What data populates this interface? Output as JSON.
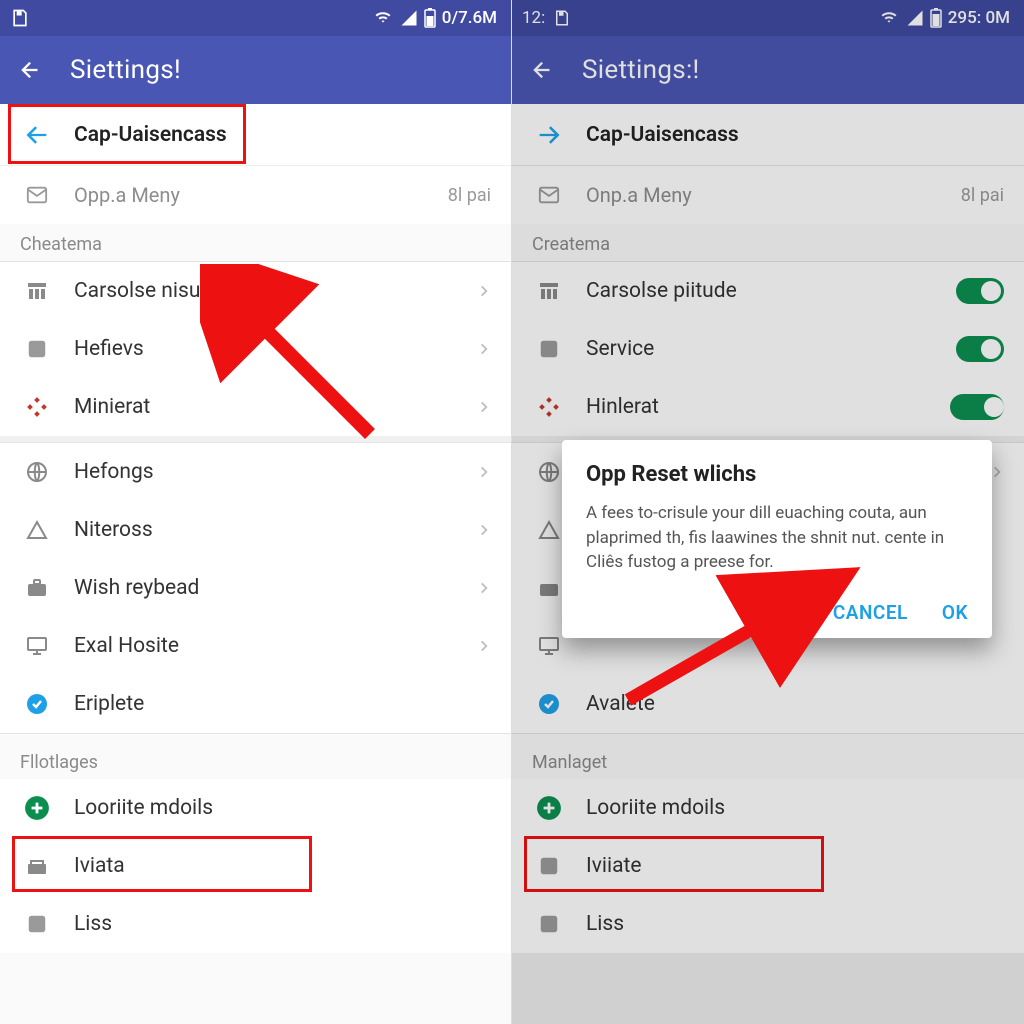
{
  "left": {
    "statusbar": {
      "left_time": "",
      "right_text": "0/7.6M"
    },
    "appbar": {
      "title": "Siettings!"
    },
    "rowA": {
      "label": "Cap-Uaisencass"
    },
    "rowMail": {
      "label": "Opp.a Meny",
      "right": "8l pai"
    },
    "subheader1": "Cheatema",
    "group1": [
      {
        "label": "Carsolse nisuds"
      },
      {
        "label": "Hefievs"
      },
      {
        "label": "Minierat"
      }
    ],
    "group2": [
      {
        "label": "Hefongs"
      },
      {
        "label": "Niteross"
      },
      {
        "label": "Wish reybead"
      },
      {
        "label": "Exal Hosite"
      },
      {
        "label": "Eriplete"
      }
    ],
    "subheader2": "Fllotlages",
    "group3": [
      {
        "label": "Looriite mdoils"
      },
      {
        "label": "Iviata"
      },
      {
        "label": "Liss"
      }
    ]
  },
  "right": {
    "statusbar": {
      "left_time": "12:",
      "right_text": "295: 0M"
    },
    "appbar": {
      "title": "Siettings:!"
    },
    "rowA": {
      "label": "Cap-Uaisencass"
    },
    "rowMail": {
      "label": "Onp.a Meny",
      "right": "8l pai"
    },
    "subheader1": "Createma",
    "group1": [
      {
        "label": "Carsolse piitude"
      },
      {
        "label": "Service"
      },
      {
        "label": "Hinlerat"
      }
    ],
    "group2_visible": [
      {
        "label": ""
      },
      {
        "label": ""
      },
      {
        "label": ""
      },
      {
        "label": ""
      },
      {
        "label": "Avalete"
      }
    ],
    "subheader2": "Manlaget",
    "group3": [
      {
        "label": "Looriite mdoils"
      },
      {
        "label": "Iviiate"
      },
      {
        "label": "Liss"
      }
    ],
    "dialog": {
      "title": "Opp Reset wlichs",
      "body": "A fees to-crisule your dill euaching couta, aun plaprimed th, fis laawines the shnit nut. cente in Cliês fustog a preese for.",
      "cancel": "CANCEL",
      "ok": "OK"
    }
  }
}
